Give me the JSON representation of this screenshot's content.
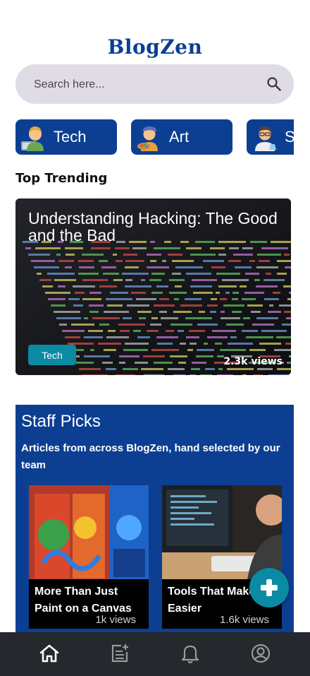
{
  "app": {
    "title": "BlogZen"
  },
  "search": {
    "placeholder": "Search here...",
    "icon": "search-icon"
  },
  "categories": [
    {
      "label": "Tech",
      "icon": "technologist-emoji-icon"
    },
    {
      "label": "Art",
      "icon": "artist-emoji-icon"
    },
    {
      "label": "S",
      "icon": "scientist-emoji-icon"
    }
  ],
  "trending": {
    "section_title": "Top Trending",
    "article": {
      "title": "Understanding Hacking: The Good and the Bad",
      "tag": "Tech",
      "views": "2.3k views"
    }
  },
  "staff_picks": {
    "title": "Staff Picks",
    "description": "Articles from across BlogZen, hand selected by our team",
    "articles": [
      {
        "title": "More Than Just Paint on a Canvas",
        "views": "1k views"
      },
      {
        "title": "Tools That Make Easier",
        "views": "1.6k views"
      }
    ]
  },
  "fab": {
    "icon": "plus-icon"
  },
  "bottom_nav": [
    {
      "icon": "home-icon",
      "active": true
    },
    {
      "icon": "post-add-icon",
      "active": false
    },
    {
      "icon": "bell-icon",
      "active": false
    },
    {
      "icon": "account-circle-icon",
      "active": false
    }
  ],
  "colors": {
    "brand": "#0c3f92",
    "accent": "#0b8aa3",
    "search_bg": "#e0dce6",
    "nav_bg": "#25282d"
  }
}
